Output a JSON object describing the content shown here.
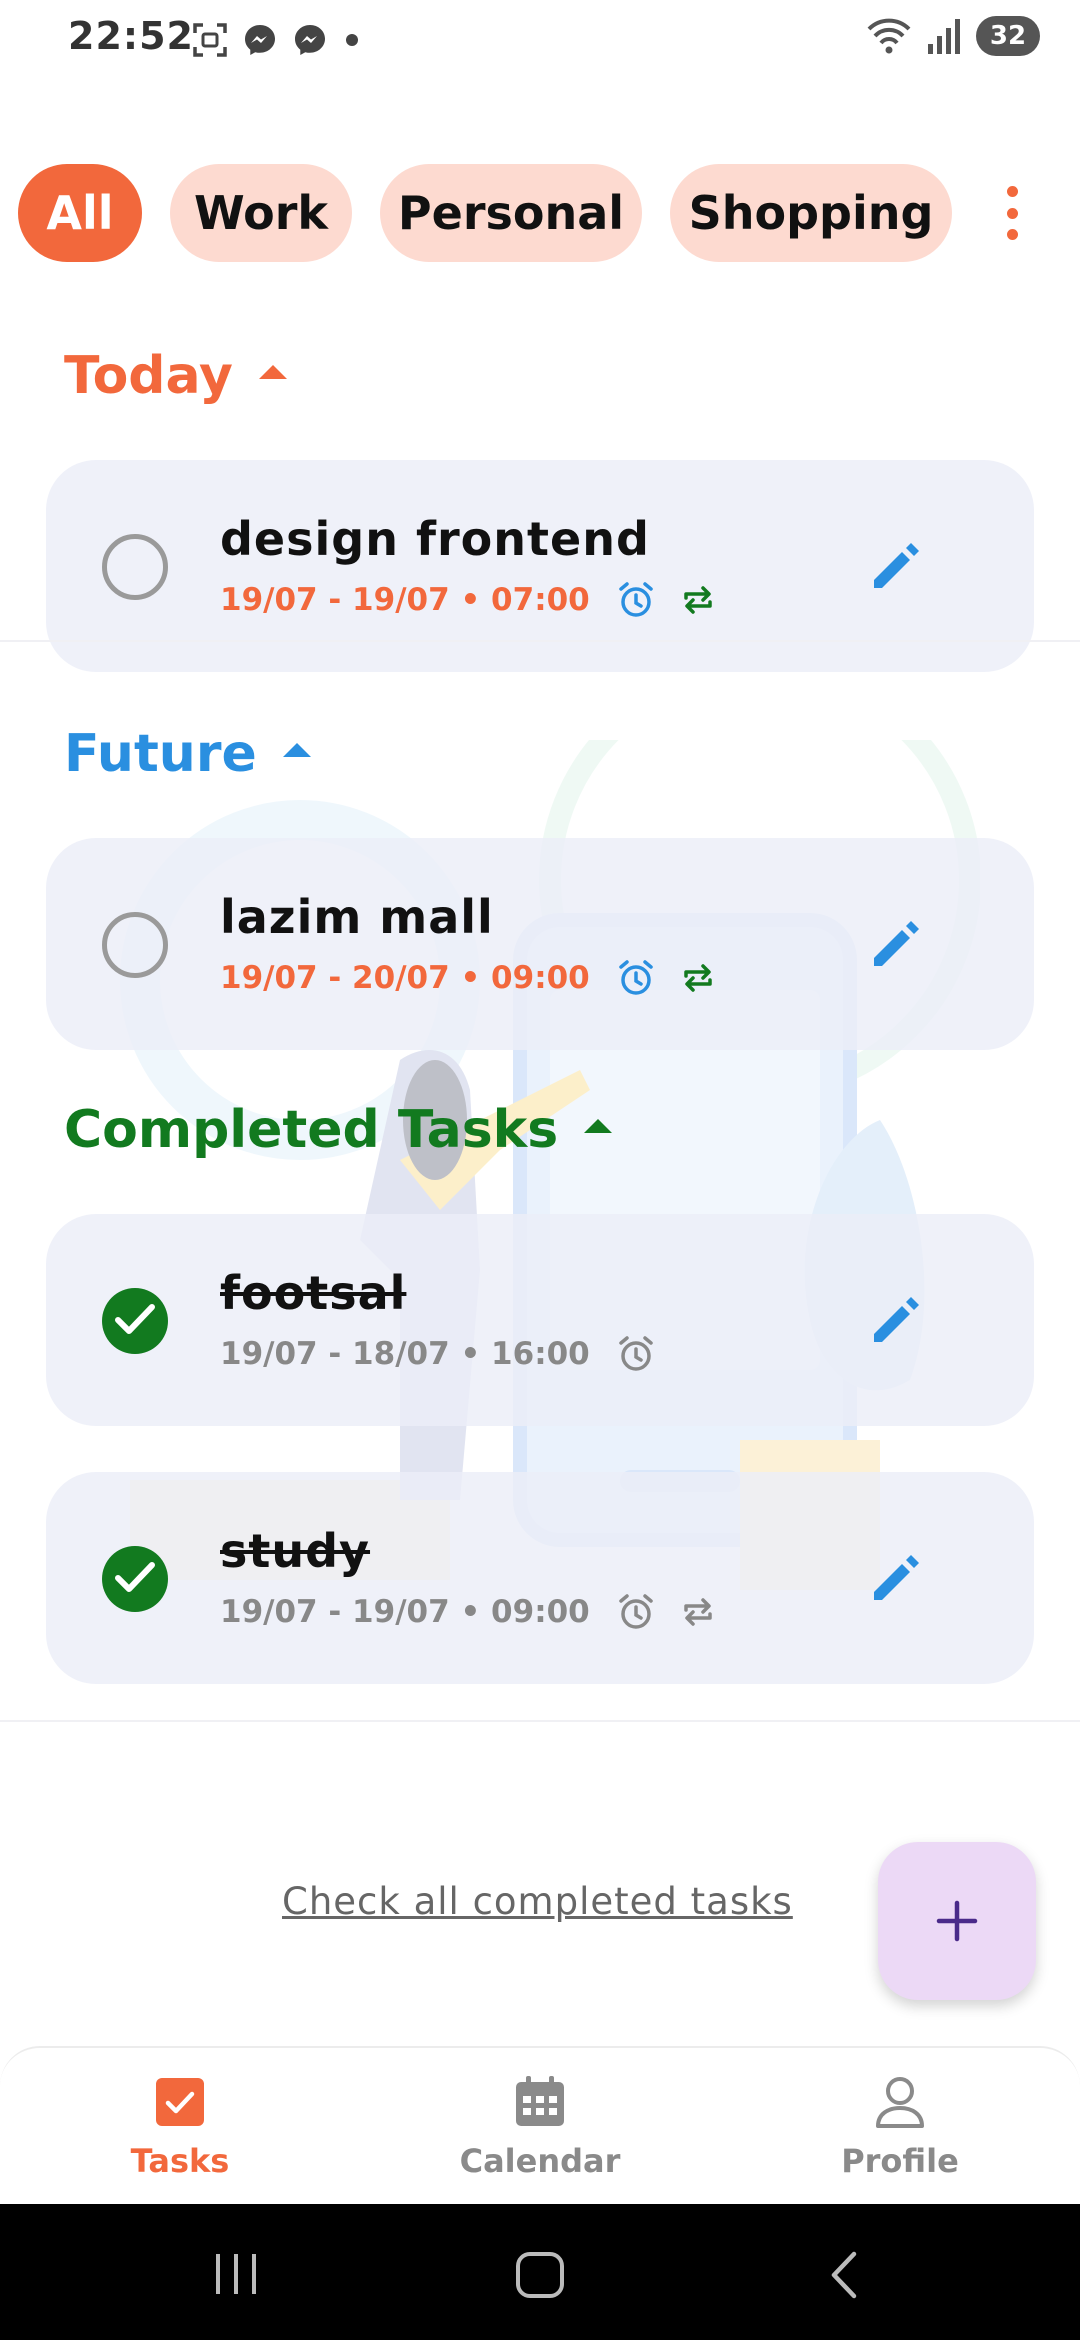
{
  "status_bar": {
    "time": "22:52",
    "battery": "32",
    "icons_left": [
      "screenshot-icon",
      "messenger-icon",
      "messenger-icon",
      "dot-icon"
    ],
    "icons_right": [
      "wifi-icon",
      "signal-icon",
      "battery-icon"
    ]
  },
  "filters": {
    "chips": [
      "All",
      "Work",
      "Personal",
      "Shopping"
    ],
    "active": "All",
    "more_icon": "more-vertical-icon"
  },
  "sections": {
    "today": {
      "title": "Today",
      "color": "#f2683c",
      "tasks": [
        {
          "title": "design frontend",
          "meta": "19/07 - 19/07 • 07:00",
          "done": false,
          "alarm": true,
          "repeat": true
        }
      ]
    },
    "future": {
      "title": "Future",
      "color": "#2a8fe0",
      "tasks": [
        {
          "title": "lazim mall",
          "meta": "19/07 - 20/07 • 09:00",
          "done": false,
          "alarm": true,
          "repeat": true
        }
      ]
    },
    "completed": {
      "title": "Completed Tasks",
      "color": "#127a1f",
      "tasks": [
        {
          "title": "footsal",
          "meta": "19/07 - 18/07 • 16:00",
          "done": true,
          "alarm": true,
          "repeat": false
        },
        {
          "title": "study",
          "meta": "19/07 - 19/07 • 09:00",
          "done": true,
          "alarm": true,
          "repeat": true
        }
      ]
    }
  },
  "colors": {
    "accent": "#f2683c",
    "chip_bg": "#fddad0",
    "future": "#2a8fe0",
    "completed": "#127a1f",
    "meta_pending": "#f2683c",
    "meta_done": "#888888",
    "edit_icon": "#2a8fe0",
    "fab_bg": "#ecd9f6"
  },
  "footer": {
    "check_all_link": "Check all completed tasks",
    "fab_icon": "plus-icon"
  },
  "bottom_nav": {
    "items": [
      {
        "label": "Tasks",
        "icon": "tasks-checkbox-icon",
        "active": true
      },
      {
        "label": "Calendar",
        "icon": "calendar-icon",
        "active": false
      },
      {
        "label": "Profile",
        "icon": "profile-icon",
        "active": false
      }
    ]
  },
  "system_nav": [
    "recents-icon",
    "home-icon",
    "back-icon"
  ]
}
